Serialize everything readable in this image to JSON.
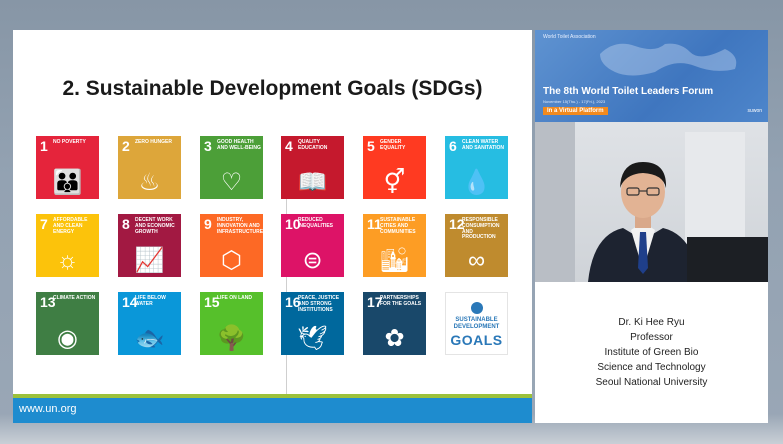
{
  "slide": {
    "title": "2. Sustainable Development Goals (SDGs)",
    "footer_url": "www.un.org",
    "goals": [
      {
        "num": "1",
        "label": "No Poverty",
        "color": "#e5243b",
        "icon": "family-icon",
        "glyph": "👪"
      },
      {
        "num": "2",
        "label": "Zero Hunger",
        "color": "#dda63a",
        "icon": "bowl-icon",
        "glyph": "♨"
      },
      {
        "num": "3",
        "label": "Good Health and Well-Being",
        "color": "#4c9f38",
        "icon": "heartbeat-icon",
        "glyph": "♡"
      },
      {
        "num": "4",
        "label": "Quality Education",
        "color": "#c5192d",
        "icon": "book-icon",
        "glyph": "📖"
      },
      {
        "num": "5",
        "label": "Gender Equality",
        "color": "#ff3a21",
        "icon": "gender-icon",
        "glyph": "⚥"
      },
      {
        "num": "6",
        "label": "Clean Water and Sanitation",
        "color": "#26bde2",
        "icon": "water-icon",
        "glyph": "💧"
      },
      {
        "num": "7",
        "label": "Affordable and Clean Energy",
        "color": "#fcc30b",
        "icon": "sun-icon",
        "glyph": "☼"
      },
      {
        "num": "8",
        "label": "Decent Work and Economic Growth",
        "color": "#a21942",
        "icon": "growth-chart-icon",
        "glyph": "📈"
      },
      {
        "num": "9",
        "label": "Industry, Innovation and Infrastructure",
        "color": "#fd6925",
        "icon": "cubes-icon",
        "glyph": "⬡"
      },
      {
        "num": "10",
        "label": "Reduced Inequalities",
        "color": "#dd1367",
        "icon": "equal-icon",
        "glyph": "⊜"
      },
      {
        "num": "11",
        "label": "Sustainable Cities and Communities",
        "color": "#fd9d24",
        "icon": "city-icon",
        "glyph": "🏙"
      },
      {
        "num": "12",
        "label": "Responsible Consumption and Production",
        "color": "#bf8b2e",
        "icon": "infinity-icon",
        "glyph": "∞"
      },
      {
        "num": "13",
        "label": "Climate Action",
        "color": "#3f7e44",
        "icon": "eye-globe-icon",
        "glyph": "◉"
      },
      {
        "num": "14",
        "label": "Life Below Water",
        "color": "#0a97d9",
        "icon": "fish-icon",
        "glyph": "🐟"
      },
      {
        "num": "15",
        "label": "Life on Land",
        "color": "#56c02b",
        "icon": "tree-icon",
        "glyph": "🌳"
      },
      {
        "num": "16",
        "label": "Peace, Justice and Strong Institutions",
        "color": "#00689d",
        "icon": "dove-icon",
        "glyph": "🕊"
      },
      {
        "num": "17",
        "label": "Partnerships for the Goals",
        "color": "#19486a",
        "icon": "rings-icon",
        "glyph": "✿"
      }
    ],
    "sdg_logo": {
      "line1": "SUSTAINABLE",
      "line2": "DEVELOPMENT",
      "line3": "GOALS"
    }
  },
  "banner": {
    "org": "World Toilet Association",
    "title": "The 8th World Toilet Leaders Forum",
    "subtitle": "November 15(Thu.) - 17(Fri.), 2023",
    "badge": "In a Virtual Platform",
    "brand": "suwon"
  },
  "speaker": {
    "name": "Dr. Ki Hee Ryu",
    "role": "Professor",
    "institute_line1": "Institute of Green Bio",
    "institute_line2": "Science and Technology",
    "university": "Seoul National University"
  }
}
